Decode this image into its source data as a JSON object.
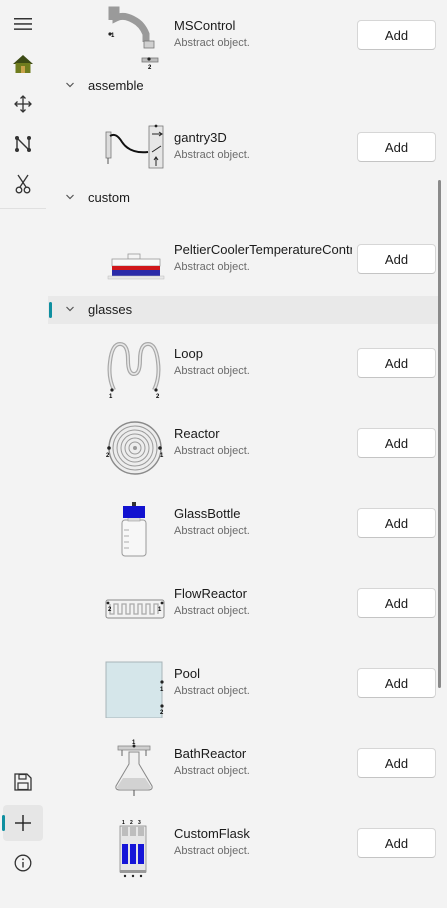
{
  "rail": {
    "top_items": [
      {
        "name": "menu-icon"
      },
      {
        "name": "home-icon"
      },
      {
        "name": "move-icon"
      },
      {
        "name": "graph-icon"
      },
      {
        "name": "scissors-icon"
      }
    ],
    "bottom_items": [
      {
        "name": "save-icon"
      },
      {
        "name": "add-icon",
        "active": true
      },
      {
        "name": "info-icon"
      }
    ]
  },
  "accent_color": "#0f8fa0",
  "add_label": "Add",
  "groups": [
    {
      "label": "assemble"
    },
    {
      "label": "custom"
    },
    {
      "label": "glasses",
      "selected": true
    }
  ],
  "items": [
    {
      "name": "MSControl",
      "desc": "Abstract object.",
      "icon": "ms-control-thumbnail"
    },
    {
      "name": "gantry3D",
      "desc": "Abstract object.",
      "icon": "gantry-thumbnail"
    },
    {
      "name": "PeltierCoolerTemperatureControl",
      "desc": "Abstract object.",
      "icon": "peltier-thumbnail"
    },
    {
      "name": "Loop",
      "desc": "Abstract object.",
      "icon": "loop-thumbnail"
    },
    {
      "name": "Reactor",
      "desc": "Abstract object.",
      "icon": "reactor-thumbnail"
    },
    {
      "name": "GlassBottle",
      "desc": "Abstract object.",
      "icon": "glass-bottle-thumbnail"
    },
    {
      "name": "FlowReactor",
      "desc": "Abstract object.",
      "icon": "flow-reactor-thumbnail"
    },
    {
      "name": "Pool",
      "desc": "Abstract object.",
      "icon": "pool-thumbnail"
    },
    {
      "name": "BathReactor",
      "desc": "Abstract object.",
      "icon": "bath-reactor-thumbnail"
    },
    {
      "name": "CustomFlask",
      "desc": "Abstract object.",
      "icon": "custom-flask-thumbnail"
    }
  ],
  "port_labels": {
    "one": "1",
    "two": "2",
    "three": "3"
  }
}
